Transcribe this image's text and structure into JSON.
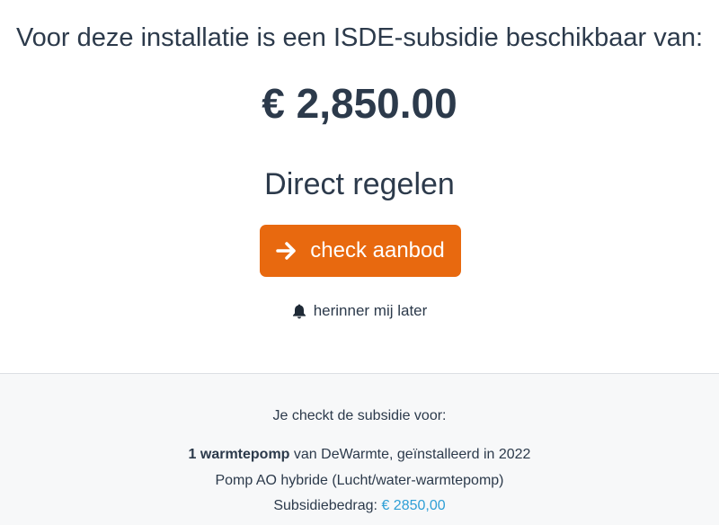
{
  "headline": "Voor deze installatie is een ISDE-subsidie beschikbaar van:",
  "amount": "€ 2,850.00",
  "subtitle": "Direct regelen",
  "cta": {
    "label": "check aanbod",
    "icon": "arrow-right-icon"
  },
  "reminder": {
    "label": "herinner mij later",
    "icon": "bell-icon"
  },
  "details": {
    "intro": "Je checkt de subsidie voor:",
    "product_count": "1 warmtepomp",
    "product_rest": "van DeWarmte, geïnstalleerd in 2022",
    "model": "Pomp AO hybride (Lucht/water-warmtepomp)",
    "subsidy_label": "Subsidiebedrag:",
    "subsidy_value": "€ 2850,00"
  },
  "colors": {
    "text": "#2c3a4b",
    "cta_background": "#e8690f",
    "link_blue": "#2e9fd6",
    "footer_background": "#f7f8f9"
  }
}
